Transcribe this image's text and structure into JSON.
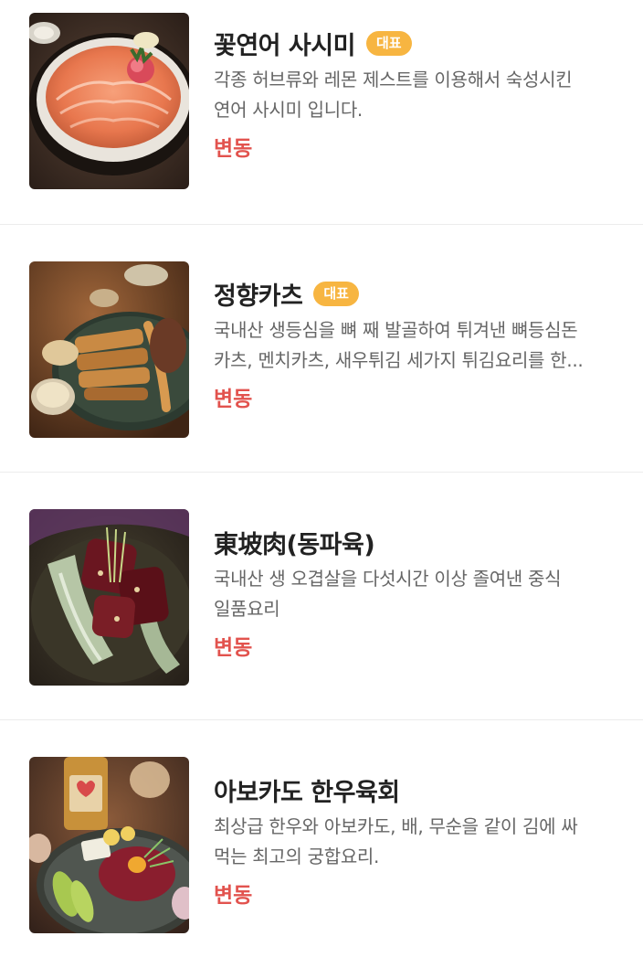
{
  "menu": {
    "items": [
      {
        "name": "꽃연어 사시미",
        "badge": "대표",
        "desc_line1": "각종 허브류와 레몬 제스트를 이용해서 숙성시킨",
        "desc_line2": "연어 사시미 입니다.",
        "price": "변동",
        "photo": "salmon-sashimi-photo"
      },
      {
        "name": "정향카츠",
        "badge": "대표",
        "desc_line1": "국내산 생등심을 뼈 째 발골하여 튀겨낸 뼈등심돈",
        "desc_line2": "카츠, 멘치카츠, 새우튀김 세가지 튀김요리를 한...",
        "price": "변동",
        "photo": "katsu-platter-photo"
      },
      {
        "name": "東坡肉(동파육)",
        "badge": "",
        "desc_line1": "국내산 생 오겹살을 다섯시간 이상 졸여낸 중식",
        "desc_line2": "일품요리",
        "price": "변동",
        "photo": "dongpo-pork-photo"
      },
      {
        "name": "아보카도 한우육회",
        "badge": "",
        "desc_line1": "최상급 한우와 아보카도, 배, 무순을 같이 김에 싸",
        "desc_line2": "먹는 최고의 궁합요리.",
        "price": "변동",
        "photo": "avocado-beef-tartare-photo"
      }
    ]
  },
  "colors": {
    "badge": "#f7b541",
    "price": "#e2534e",
    "title": "#222222",
    "description": "#666666",
    "divider": "#ececec"
  }
}
